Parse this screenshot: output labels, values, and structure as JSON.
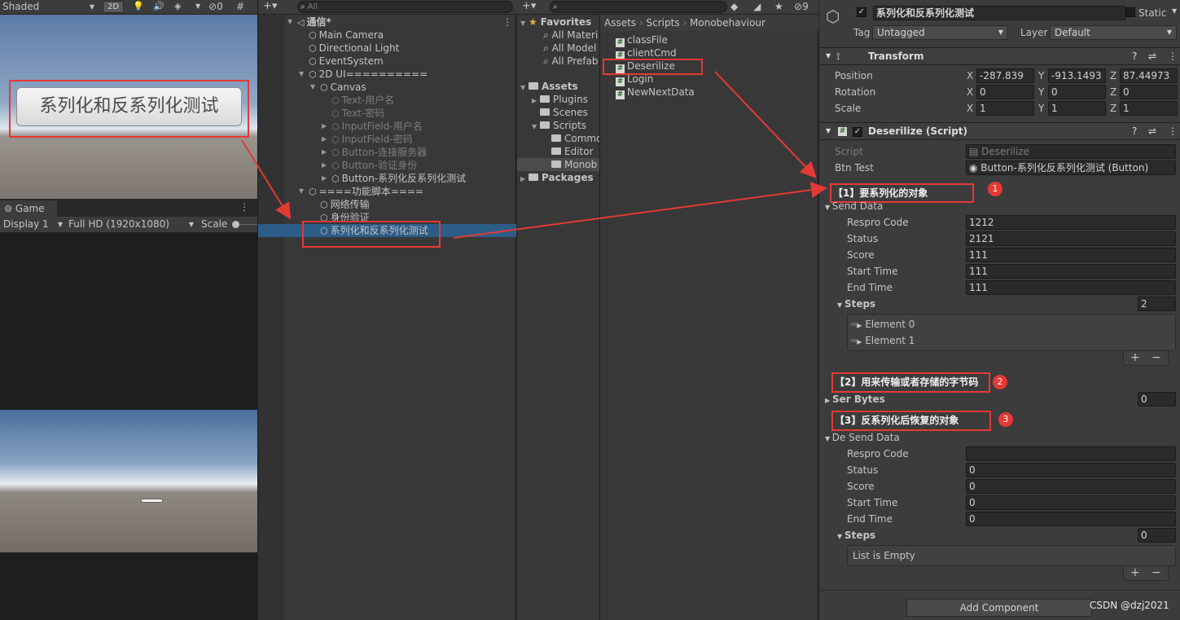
{
  "scene_view": {
    "shading": "Shaded",
    "mode_2d": "2D",
    "hidden_count": "0",
    "overlay_button": "系列化和反系列化测试"
  },
  "game_view": {
    "tab": "Game",
    "display": "Display 1",
    "resolution": "Full HD (1920x1080)",
    "scale_label": "Scale"
  },
  "hierarchy": {
    "search_placeholder": "All",
    "items": [
      {
        "label": "通信*",
        "indent": 0,
        "expanded": true,
        "bold": true,
        "icon": "unity-scene-icon"
      },
      {
        "label": "Main Camera",
        "indent": 1
      },
      {
        "label": "Directional Light",
        "indent": 1
      },
      {
        "label": "EventSystem",
        "indent": 1
      },
      {
        "label": "2D UI==========",
        "indent": 1,
        "expanded": true
      },
      {
        "label": "Canvas",
        "indent": 2,
        "expanded": true
      },
      {
        "label": "Text-用户名",
        "indent": 3,
        "dim": true
      },
      {
        "label": "Text-密码",
        "indent": 3,
        "dim": true
      },
      {
        "label": "InputField-用户名",
        "indent": 3,
        "dim": true,
        "collapsed": true
      },
      {
        "label": "InputField-密码",
        "indent": 3,
        "dim": true,
        "collapsed": true
      },
      {
        "label": "Button-连接服务器",
        "indent": 3,
        "dim": true,
        "collapsed": true
      },
      {
        "label": "Button-验证身份",
        "indent": 3,
        "dim": true,
        "collapsed": true
      },
      {
        "label": "Button-系列化反系列化测试",
        "indent": 3,
        "collapsed": true
      },
      {
        "label": "====功能脚本====",
        "indent": 1,
        "expanded": true
      },
      {
        "label": "网络传输",
        "indent": 2
      },
      {
        "label": "身份验证",
        "indent": 2
      },
      {
        "label": "系列化和反系列化测试",
        "indent": 2,
        "selected": true
      }
    ]
  },
  "project": {
    "favorites_label": "Favorites",
    "favorites": [
      "All Materi",
      "All Model",
      "All Prefab"
    ],
    "assets_label": "Assets",
    "assets_tree": [
      {
        "label": "Plugins",
        "indent": 1,
        "collapsed": true
      },
      {
        "label": "Scenes",
        "indent": 1
      },
      {
        "label": "Scripts",
        "indent": 1,
        "expanded": true
      },
      {
        "label": "Commo",
        "indent": 2
      },
      {
        "label": "Editor",
        "indent": 2
      },
      {
        "label": "Monob",
        "indent": 2,
        "selected": true
      }
    ],
    "packages_label": "Packages",
    "breadcrumb": [
      "Assets",
      "Scripts",
      "Monobehaviour"
    ],
    "files": [
      "classFile",
      "clientCmd",
      "Deserilize",
      "Login",
      "NewNextData"
    ],
    "hidden_count": "9"
  },
  "inspector": {
    "object_name": "系列化和反系列化测试",
    "static_label": "Static",
    "tag_label": "Tag",
    "tag_value": "Untagged",
    "layer_label": "Layer",
    "layer_value": "Default",
    "transform": {
      "title": "Transform",
      "position": {
        "label": "Position",
        "x": "-287.839",
        "y": "-913.1493",
        "z": "87.44973"
      },
      "rotation": {
        "label": "Rotation",
        "x": "0",
        "y": "0",
        "z": "0"
      },
      "scale": {
        "label": "Scale",
        "x": "1",
        "y": "1",
        "z": "1"
      }
    },
    "script_component": {
      "title": "Deserilize (Script)",
      "script_label": "Script",
      "script_value": "Deserilize",
      "btn_test_label": "Btn Test",
      "btn_test_value": "Button-系列化反系列化测试 (Button)",
      "send_data_label": "Send Data",
      "send_data": [
        {
          "label": "Respro Code",
          "value": "1212"
        },
        {
          "label": "Status",
          "value": "2121"
        },
        {
          "label": "Score",
          "value": "111"
        },
        {
          "label": "Start Time",
          "value": "111"
        },
        {
          "label": "End Time",
          "value": "111"
        }
      ],
      "steps_label": "Steps",
      "steps_count": "2",
      "elements": [
        "Element 0",
        "Element 1"
      ],
      "ser_bytes_label": "Ser Bytes",
      "ser_bytes_count": "0",
      "de_send_data_label": "De Send Data",
      "de_send_data": [
        {
          "label": "Respro Code",
          "value": ""
        },
        {
          "label": "Status",
          "value": "0"
        },
        {
          "label": "Score",
          "value": "0"
        },
        {
          "label": "Start Time",
          "value": "0"
        },
        {
          "label": "End Time",
          "value": "0"
        }
      ],
      "de_steps_label": "Steps",
      "de_steps_count": "0",
      "list_empty": "List is Empty"
    },
    "add_component": "Add Component"
  },
  "annotations": [
    {
      "text": "【1】要系列化的对象",
      "number": "1"
    },
    {
      "text": "【2】用来传输或者存储的字节码",
      "number": "2"
    },
    {
      "text": "【3】反系列化后恢复的对象",
      "number": "3"
    }
  ],
  "watermark": "CSDN @dzj2021",
  "colors": {
    "accent_red": "#e53935",
    "selected_blue": "#2c5d87",
    "panel_bg": "#383838"
  }
}
